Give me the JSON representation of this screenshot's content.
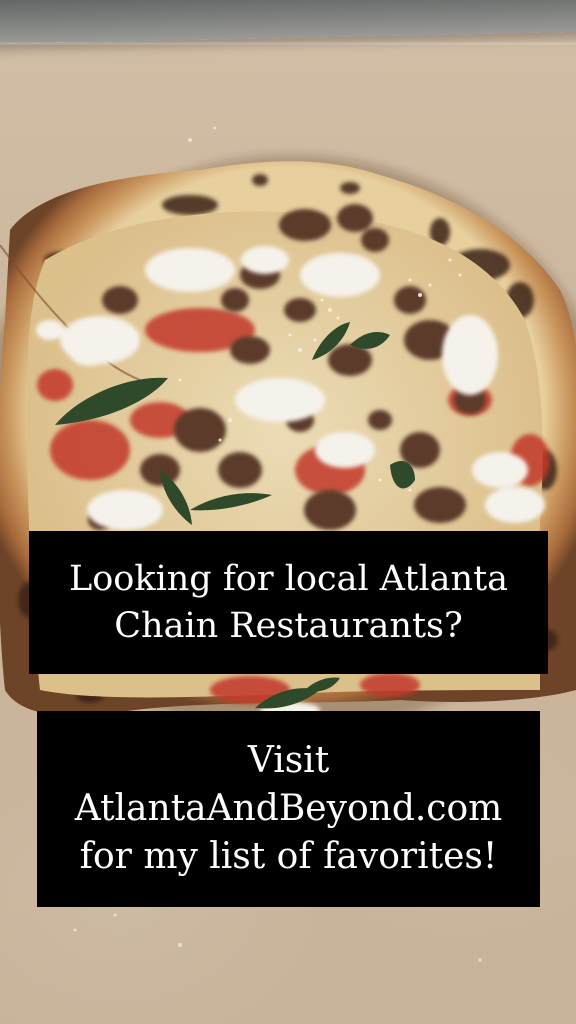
{
  "scene": {
    "subject": "pizza",
    "colors": {
      "paper": "#cdb9a1",
      "crust": "#c48a55",
      "char": "#3a2418",
      "sauce": "#c0362a",
      "mozzarella": "#f4f1ea",
      "sausage": "#5a3a2a",
      "basil": "#2f4a2a",
      "caption_bg": "#000000",
      "caption_text": "#ffffff"
    }
  },
  "captions": [
    {
      "lines": [
        "Looking for local Atlanta",
        "Chain Restaurants?"
      ]
    },
    {
      "lines": [
        "Visit",
        "AtlantaAndBeyond.com",
        "for my list of favorites!"
      ]
    }
  ]
}
